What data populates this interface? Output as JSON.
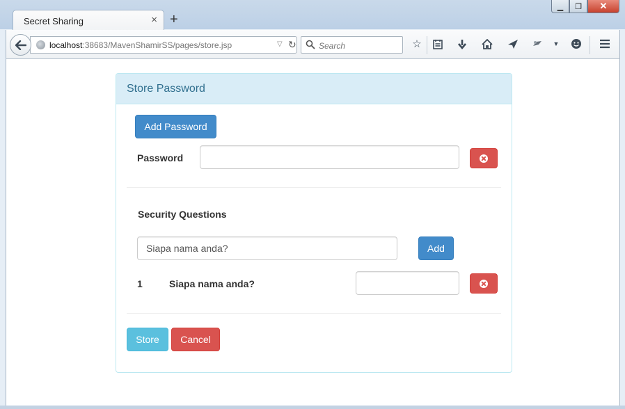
{
  "browser": {
    "tab_title": "Secret Sharing",
    "tab_close": "×",
    "new_tab": "+",
    "window_controls": [
      "minimize-icon",
      "restore-icon",
      "close-icon"
    ],
    "url_host": "localhost",
    "url_rest": ":38683/MavenShamirSS/pages/store.jsp",
    "search_placeholder": "Search",
    "toolbar_icons": [
      "bookmark-star-icon",
      "reading-list-icon",
      "download-icon",
      "home-icon",
      "send-icon",
      "extension-icon",
      "dropdown-arrow-icon",
      "smiley-icon",
      "menu-icon"
    ]
  },
  "panel": {
    "title": "Store Password",
    "add_password_label": "Add Password",
    "password_label": "Password",
    "password_value": "",
    "security_questions_label": "Security Questions",
    "question_input_value": "Siapa nama anda?",
    "add_label": "Add",
    "questions": [
      {
        "number": "1",
        "text": "Siapa nama anda?",
        "answer": ""
      }
    ],
    "store_label": "Store",
    "cancel_label": "Cancel"
  },
  "colors": {
    "primary": "#428bca",
    "danger": "#d9534f",
    "info": "#5bc0de",
    "panel_heading_bg": "#d9edf7",
    "panel_title": "#31708f"
  }
}
